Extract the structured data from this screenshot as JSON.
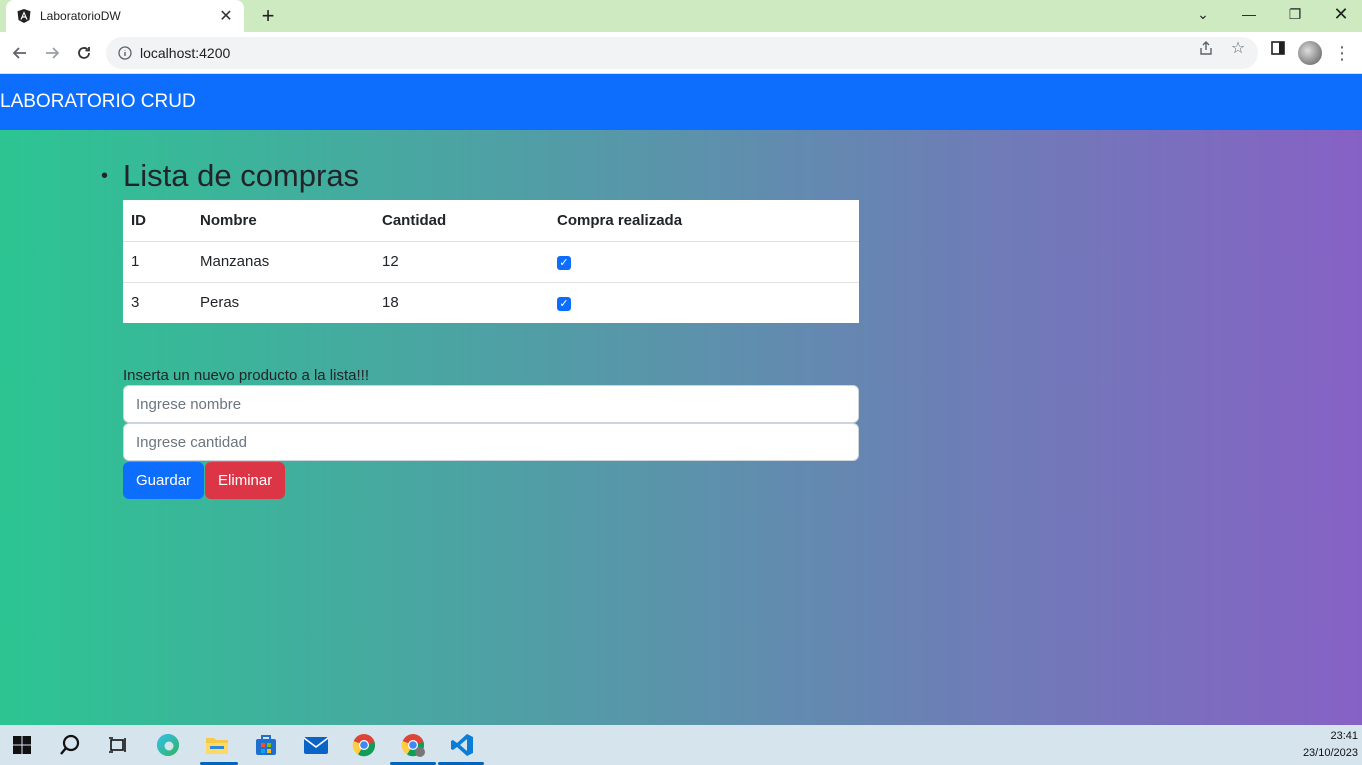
{
  "browser": {
    "tab_title": "LaboratorioDW",
    "url": "localhost:4200"
  },
  "navbar": {
    "brand": "LABORATORIO CRUD"
  },
  "main": {
    "title": "Lista de compras",
    "table": {
      "headers": [
        "ID",
        "Nombre",
        "Cantidad",
        "Compra realizada"
      ],
      "rows": [
        {
          "id": "1",
          "nombre": "Manzanas",
          "cantidad": "12",
          "comprado": true
        },
        {
          "id": "3",
          "nombre": "Peras",
          "cantidad": "18",
          "comprado": true
        }
      ]
    },
    "form": {
      "prompt": "Inserta un nuevo producto a la lista!!!",
      "nombre_placeholder": "Ingrese nombre",
      "cantidad_placeholder": "Ingrese cantidad",
      "save_label": "Guardar",
      "delete_label": "Eliminar"
    }
  },
  "taskbar": {
    "time": "23:41",
    "date": "23/10/2023",
    "icons": [
      "windows-start-icon",
      "search-icon",
      "task-view-icon",
      "edge-icon",
      "file-explorer-icon",
      "store-icon",
      "mail-icon",
      "chrome-icon",
      "chrome-profile-icon",
      "vscode-icon"
    ]
  },
  "colors": {
    "navbar": "#0d6efd",
    "gradient_start": "#2cc592",
    "gradient_end": "#8661c5",
    "save_button": "#0d6efd",
    "delete_button": "#dc3545"
  }
}
